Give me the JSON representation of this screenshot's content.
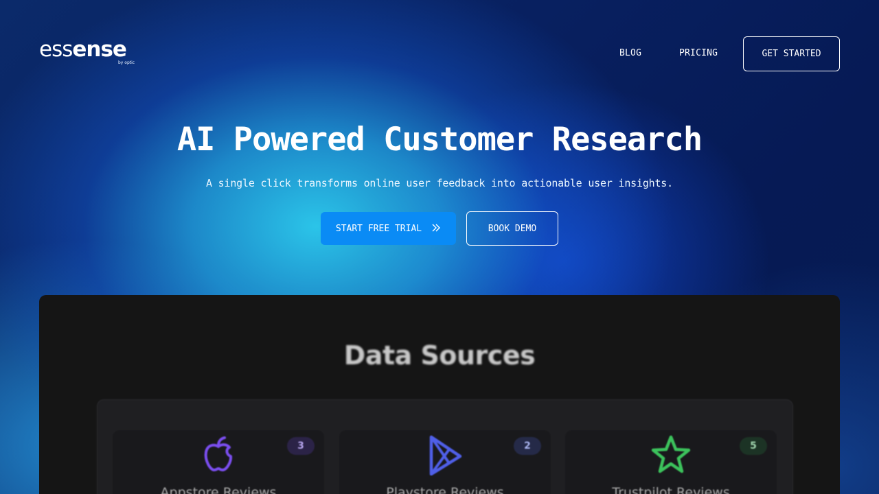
{
  "brand": {
    "name_light": "ess",
    "name_bold": "ense",
    "tagline": "by optic"
  },
  "nav": {
    "items": [
      {
        "label": "BLOG"
      },
      {
        "label": "PRICING"
      }
    ],
    "cta_label": "GET STARTED"
  },
  "hero": {
    "title": "AI Powered Customer Research",
    "subtitle": "A single click transforms online user feedback into actionable user insights.",
    "primary_cta": "START FREE TRIAL",
    "primary_cta_icon": "double-chevron-right-icon",
    "secondary_cta": "BOOK DEMO"
  },
  "preview": {
    "title": "Data Sources",
    "sources": [
      {
        "label": "Appstore Reviews",
        "count": "3",
        "icon": "apple-icon",
        "color": "#7b4ef0"
      },
      {
        "label": "Playstore Reviews",
        "count": "2",
        "icon": "play-store-icon",
        "color": "#4f5fe8"
      },
      {
        "label": "Trustpilot Reviews",
        "count": "5",
        "icon": "star-icon",
        "color": "#3cc35c"
      }
    ]
  },
  "colors": {
    "primary_button": "#0a8bf5",
    "preview_bg": "#151515"
  }
}
